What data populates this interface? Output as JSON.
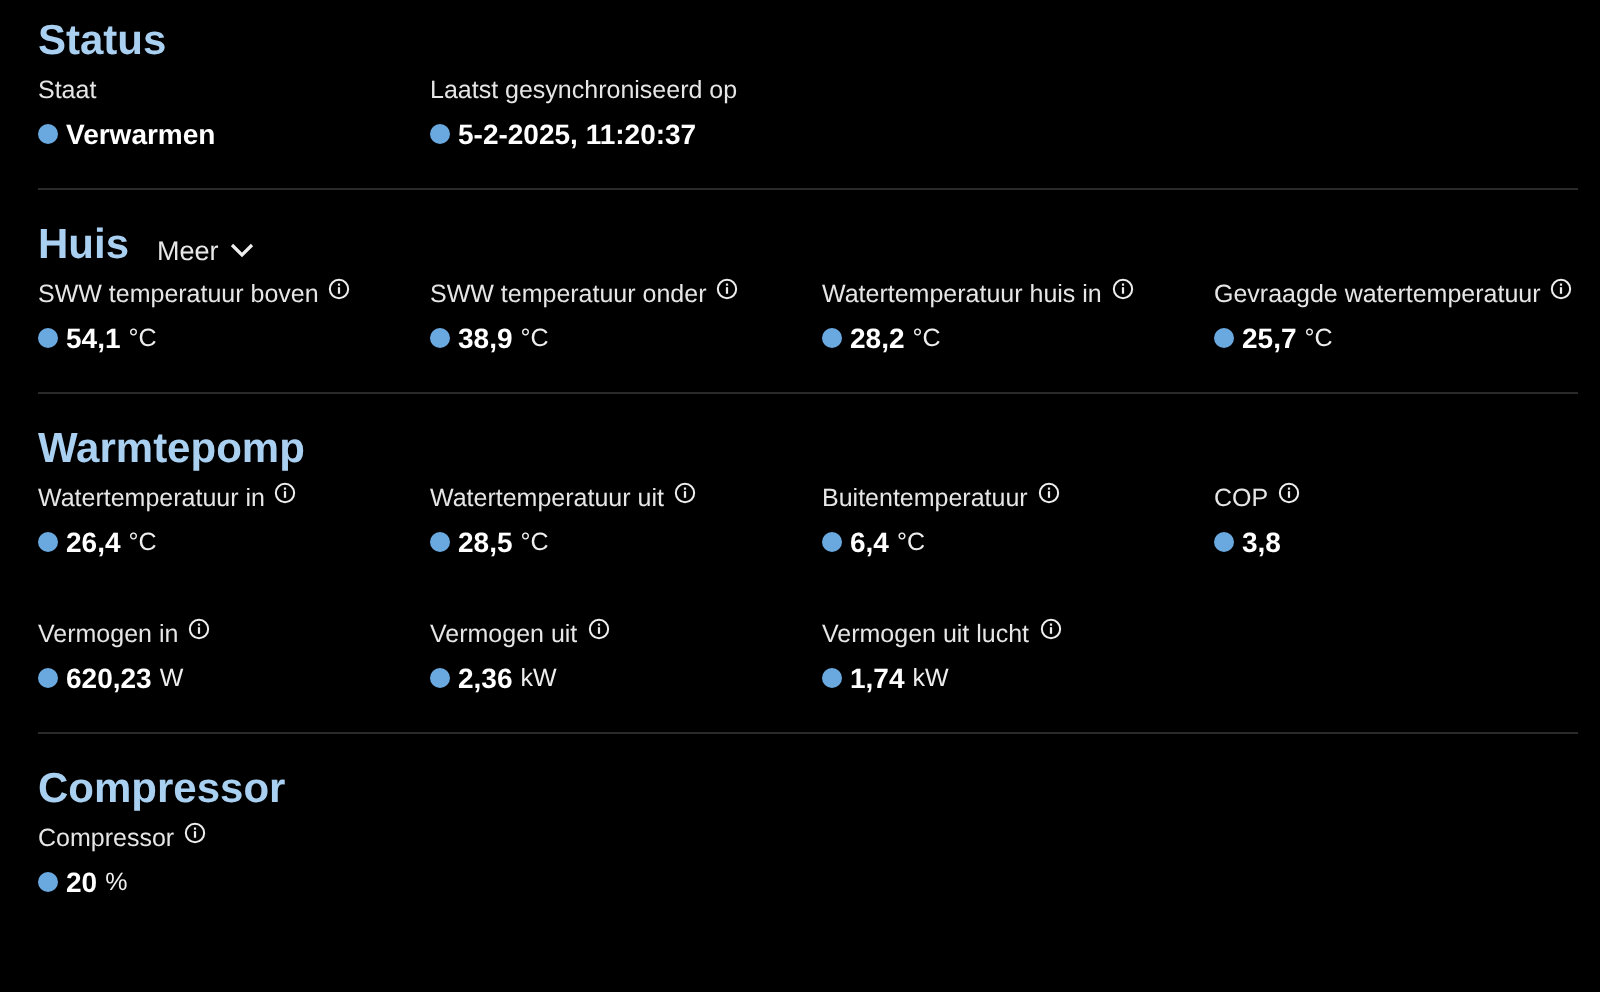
{
  "sections": [
    {
      "title": "Status",
      "items": [
        {
          "label": "Staat",
          "info": false,
          "value": "Verwarmen"
        },
        {
          "label": "Laatst gesynchroniseerd op",
          "info": false,
          "value": "5-2-2025, 11:20:37"
        }
      ]
    },
    {
      "title": "Huis",
      "more": "Meer",
      "items": [
        {
          "label": "SWW temperatuur boven",
          "info": true,
          "value": "54,1",
          "unit": "°C"
        },
        {
          "label": "SWW temperatuur onder",
          "info": true,
          "value": "38,9",
          "unit": "°C"
        },
        {
          "label": "Watertemperatuur huis in",
          "info": true,
          "value": "28,2",
          "unit": "°C"
        },
        {
          "label": "Gevraagde watertemperatuur",
          "info": true,
          "value": "25,7",
          "unit": "°C"
        }
      ]
    },
    {
      "title": "Warmtepomp",
      "items": [
        {
          "label": "Watertemperatuur in",
          "info": true,
          "value": "26,4",
          "unit": "°C"
        },
        {
          "label": "Watertemperatuur uit",
          "info": true,
          "value": "28,5",
          "unit": "°C"
        },
        {
          "label": "Buitentemperatuur",
          "info": true,
          "value": "6,4",
          "unit": "°C"
        },
        {
          "label": "COP",
          "info": true,
          "value": "3,8"
        },
        {
          "label": "Vermogen in",
          "info": true,
          "value": "620,23",
          "unit": "W"
        },
        {
          "label": "Vermogen uit",
          "info": true,
          "value": "2,36",
          "unit": "kW"
        },
        {
          "label": "Vermogen uit lucht",
          "info": true,
          "value": "1,74",
          "unit": "kW"
        }
      ]
    },
    {
      "title": "Compressor",
      "items": [
        {
          "label": "Compressor",
          "info": true,
          "value": "20",
          "unit": "%"
        }
      ]
    }
  ]
}
